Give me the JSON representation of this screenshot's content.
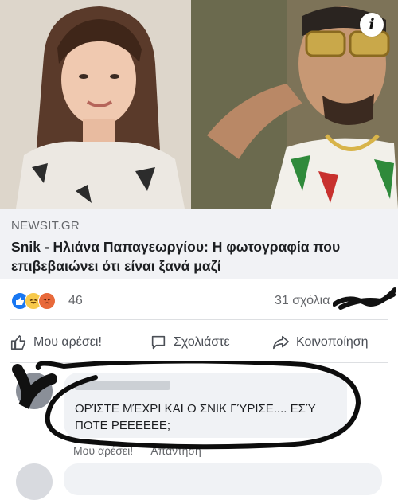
{
  "link_preview": {
    "source": "NEWSIT.GR",
    "title": "Snik - Ηλιάνα Παπαγεωργίου: Η φωτογραφία που επιβεβαιώνει ότι είναι ξανά μαζί"
  },
  "reactions": {
    "types": [
      "like-icon",
      "haha-icon",
      "angry-icon"
    ],
    "count": "46"
  },
  "comments_count": "31 σχόλια",
  "actions": {
    "like": "Μου αρέσει!",
    "comment": "Σχολιάστε",
    "share": "Κοινοποίηση"
  },
  "comment": {
    "text": "ΟΡΊΣΤΕ ΜΈΧΡΙ ΚΑΙ Ο ΣΝΙΚ ΓΎΡΙΣΕ.... ΕΣΎ ΠΟΤΕ ΡΕΕΕΕΕΕ;",
    "like": "Μου αρέσει!",
    "reply": "Απάντηση"
  },
  "colors": {
    "brand_blue": "#1877f2",
    "link_box_bg": "#f1f2f5",
    "muted_text": "#65676b"
  }
}
